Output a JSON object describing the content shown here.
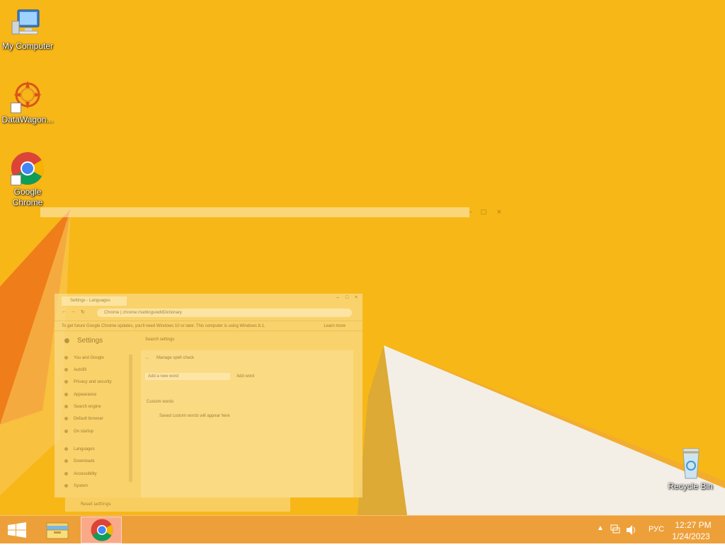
{
  "desktop": {
    "icons": [
      {
        "label": "My Computer",
        "icon": "computer-icon"
      },
      {
        "label": "DataWagon...",
        "icon": "datawagon-icon"
      },
      {
        "label": "Google Chrome",
        "icon": "chrome-icon"
      },
      {
        "label": "Recycle Bin",
        "icon": "recycle-bin-icon"
      }
    ],
    "wallpaper_colors": {
      "base": "#f7b717",
      "shape_orange": "#ef7d1a",
      "shape_white": "#f3efe6",
      "shadow": "#c9a24a"
    }
  },
  "ghost_window": {
    "tab_title": "Settings - Languages",
    "address": "Chrome | chrome://settings/editDictionary",
    "infobar_text": "To get future Google Chrome updates, you'll need Windows 10 or later. This computer is using Windows 8.1.",
    "infobar_dismiss": "Learn more",
    "settings_title": "Settings",
    "search_placeholder": "Search settings",
    "sidebar_items": [
      "You and Google",
      "Autofill",
      "Privacy and security",
      "Appearance",
      "Search engine",
      "Default browser",
      "On startup",
      "Languages",
      "Downloads",
      "Accessibility",
      "System",
      "Reset settings"
    ],
    "content": {
      "back_title": "Manage spell check",
      "add_placeholder": "Add a new word",
      "add_button": "Add word",
      "section_title": "Custom words",
      "empty_text": "Saved custom words will appear here"
    }
  },
  "taskbar": {
    "start_label": "Start",
    "lang": "РУС",
    "time": "12:27 PM",
    "date": "1/24/2023",
    "accent": "#ec9d34"
  }
}
